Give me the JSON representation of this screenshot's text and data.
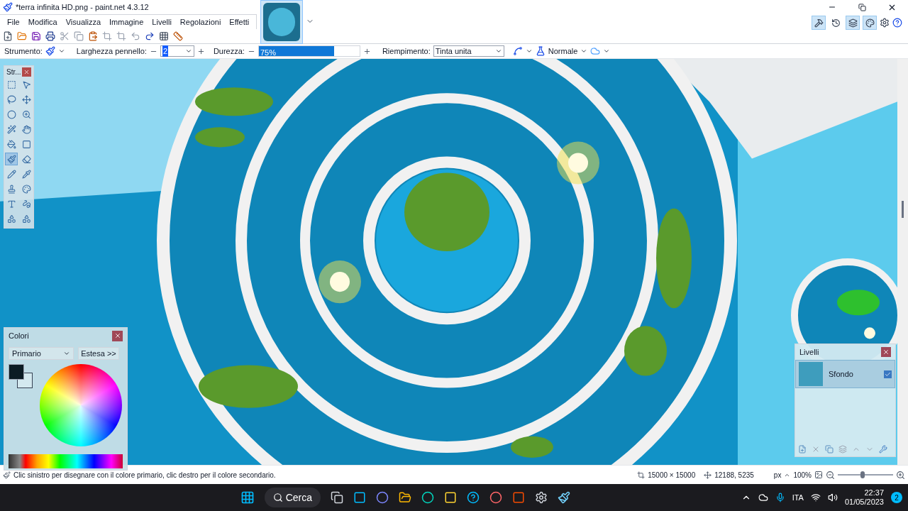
{
  "window": {
    "title": "*terra infinita HD.png - paint.net 4.3.12"
  },
  "menu": [
    "File",
    "Modifica",
    "Visualizza",
    "Immagine",
    "Livelli",
    "Regolazioni",
    "Effetti"
  ],
  "panel_toggles": [
    {
      "selected": true
    },
    {
      "selected": false
    },
    {
      "selected": true
    },
    {
      "selected": true
    }
  ],
  "tool_options": {
    "tool_label": "Strumento:",
    "width_label": "Larghezza pennello:",
    "width_value": "2",
    "hardness_label": "Durezza:",
    "hardness": {
      "reading": "75%",
      "level": 0.75
    },
    "fill_label": "Riempimento:",
    "fill_value": "Tinta unita",
    "blend_value": "Normale"
  },
  "tools_panel": {
    "title": "Str...",
    "tools": [
      {
        "selected": false
      },
      {
        "selected": false
      },
      {
        "selected": false
      },
      {
        "selected": false
      },
      {
        "selected": false
      },
      {
        "selected": false
      },
      {
        "selected": false
      },
      {
        "selected": false
      },
      {
        "selected": false
      },
      {
        "selected": false
      },
      {
        "selected": true
      },
      {
        "selected": false
      },
      {
        "selected": false
      },
      {
        "selected": false
      },
      {
        "selected": false
      },
      {
        "selected": false
      },
      {
        "selected": false
      },
      {
        "selected": false
      },
      {
        "selected": false
      },
      {
        "selected": false
      }
    ]
  },
  "colors_panel": {
    "title": "Colori",
    "mode": "Primario",
    "more_button": "Estesa >>"
  },
  "layers_panel": {
    "title": "Livelli",
    "layers": [
      {
        "name": "Sfondo",
        "visible": true,
        "selected": true
      }
    ]
  },
  "status_bar": {
    "hint": "Clic sinistro per disegnare con il colore primario, clic destro per il colore secondario.",
    "image_size": "15000 × 15000",
    "cursor": "12188, 5235",
    "unit": "px",
    "zoom": "100%",
    "zoom_slider": {
      "level": 0.45
    }
  },
  "taskbar": {
    "search": "Cerca",
    "language": "ITA",
    "time": "22:37",
    "date": "01/05/2023",
    "notifications": "2"
  }
}
